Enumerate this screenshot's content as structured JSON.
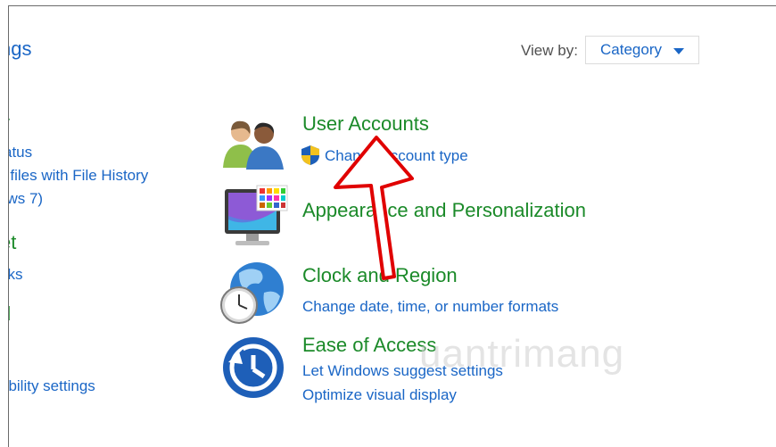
{
  "left_panel": {
    "title_partial": "ngs",
    "system_security_partial": "y",
    "link_status_partial": "atus",
    "link_file_history_partial": "r files with File History",
    "link_backup_partial": "ows 7)",
    "network_partial": "et",
    "link_tasks_partial": "sks",
    "hardware_partial": "d",
    "link_mobility_partial": "obility settings"
  },
  "view_by": {
    "label": "View by:",
    "value": "Category"
  },
  "categories": [
    {
      "heading": "User Accounts",
      "links": [
        "Change account type"
      ],
      "icon": "users-icon"
    },
    {
      "heading": "Appearance and Personalization",
      "links": [],
      "icon": "monitor-palette-icon"
    },
    {
      "heading": "Clock and Region",
      "links": [
        "Change date, time, or number formats"
      ],
      "icon": "globe-clock-icon"
    },
    {
      "heading": "Ease of Access",
      "links": [
        "Let Windows suggest settings",
        "Optimize visual display"
      ],
      "icon": "ease-of-access-icon"
    }
  ],
  "watermark": "uantrimang",
  "colors": {
    "link": "#1a66c6",
    "heading": "#1b8a29",
    "arrow": "#e00000"
  }
}
